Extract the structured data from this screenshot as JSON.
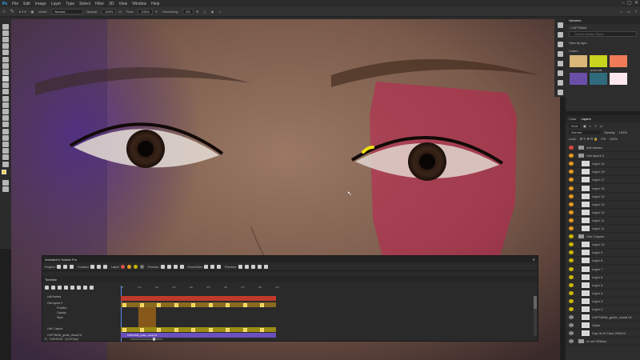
{
  "menubar": [
    "File",
    "Edit",
    "Image",
    "Layer",
    "Type",
    "Select",
    "Filter",
    "3D",
    "View",
    "Window",
    "Help"
  ],
  "options": {
    "mode_label": "Mode:",
    "mode": "Normal",
    "opacity_label": "Opacity:",
    "opacity": "100%",
    "flow_label": "Flow:",
    "flow": "100%",
    "smoothing_label": "Smoothing:",
    "smoothing": "0%"
  },
  "libraries": {
    "title": "Libraries",
    "library_name": "CAPTAINA",
    "search_placeholder": "Search Adobe Stock",
    "view_by": "View by type",
    "colors_label": "Colors",
    "swatch_caption": "HOTA C35"
  },
  "swatches": [
    "#d9b779",
    "#c8d41e",
    "#ef7b58",
    "#6a4fa8",
    "#2f6b7c",
    "#fce8ee"
  ],
  "layers": {
    "tabs": [
      "Color",
      "Layers"
    ],
    "kind": "Kind",
    "blend": "Normal",
    "opacity_label": "Opacity:",
    "opacity": "100%",
    "lock_label": "Lock:",
    "fill_label": "Fill:",
    "fill": "100%",
    "rows": [
      {
        "name": "edit frames",
        "type": "group",
        "color": "#e0453f"
      },
      {
        "name": "Owl layout 3",
        "type": "group",
        "color": "#e89a1f"
      },
      {
        "name": "Layer 10",
        "type": "layer",
        "color": "#e89a1f"
      },
      {
        "name": "Layer 19",
        "type": "layer",
        "color": "#e89a1f"
      },
      {
        "name": "Layer 17",
        "type": "layer",
        "color": "#e89a1f"
      },
      {
        "name": "Layer 15",
        "type": "layer",
        "color": "#e89a1f"
      },
      {
        "name": "Layer 14",
        "type": "layer",
        "color": "#e89a1f"
      },
      {
        "name": "Layer 13",
        "type": "layer",
        "color": "#e89a1f"
      },
      {
        "name": "Layer 12",
        "type": "layer",
        "color": "#e89a1f"
      },
      {
        "name": "Layer 11",
        "type": "layer",
        "color": "#e89a1f"
      },
      {
        "name": "Layer 11",
        "type": "layer",
        "color": "#e89a1f"
      },
      {
        "name": "Owl 1 layers",
        "type": "group",
        "color": "#c9b600"
      },
      {
        "name": "Layer 10",
        "type": "layer",
        "color": "#c9b600"
      },
      {
        "name": "Layer 9",
        "type": "layer",
        "color": "#c9b600"
      },
      {
        "name": "Layer 8",
        "type": "layer",
        "color": "#c9b600"
      },
      {
        "name": "Layer 7",
        "type": "layer",
        "color": "#c9b600"
      },
      {
        "name": "Layer 6",
        "type": "layer",
        "color": "#c9b600"
      },
      {
        "name": "Layer 5",
        "type": "layer",
        "color": "#c9b600"
      },
      {
        "name": "Layer 4",
        "type": "layer",
        "color": "#c9b600"
      },
      {
        "name": "Layer 3",
        "type": "layer",
        "color": "#c9b600"
      },
      {
        "name": "Layer 2",
        "type": "layer",
        "color": "#c9b600"
      },
      {
        "name": "CAPTAINA_guide_visual 01",
        "type": "layer",
        "color": "#888888"
      },
      {
        "name": "Video",
        "type": "layer",
        "color": "#888888"
      },
      {
        "name": "Cap Hi-Hi Face 205324",
        "type": "layer",
        "color": "#888888"
      },
      {
        "name": "ex set 005bes",
        "type": "group",
        "color": "#888888"
      }
    ]
  },
  "animator": {
    "title": "Animator's Toolbar Pro",
    "project_label": "Project:",
    "content_label": "Content:",
    "label_label": "Label:",
    "frames_label": "Frames:",
    "onionskin_label": "OnionSkin:",
    "preview_label": "Preview:",
    "timeline_title": "Timeline",
    "timecode": "0:00:00:00",
    "fps": "(12.00 fps)",
    "tracks": [
      "edit frames",
      "Owl layout 3",
      "Position",
      "Opacity",
      "Style",
      "Owl 1 layout",
      "CAPTAINA_guide_visual 01"
    ],
    "clip_label": "CAPTAINA_guide_visual 01",
    "ruler": [
      "00",
      "01f",
      "02f",
      "03f",
      "04f",
      "05f",
      "06f",
      "07f",
      "08f",
      "09f"
    ]
  }
}
